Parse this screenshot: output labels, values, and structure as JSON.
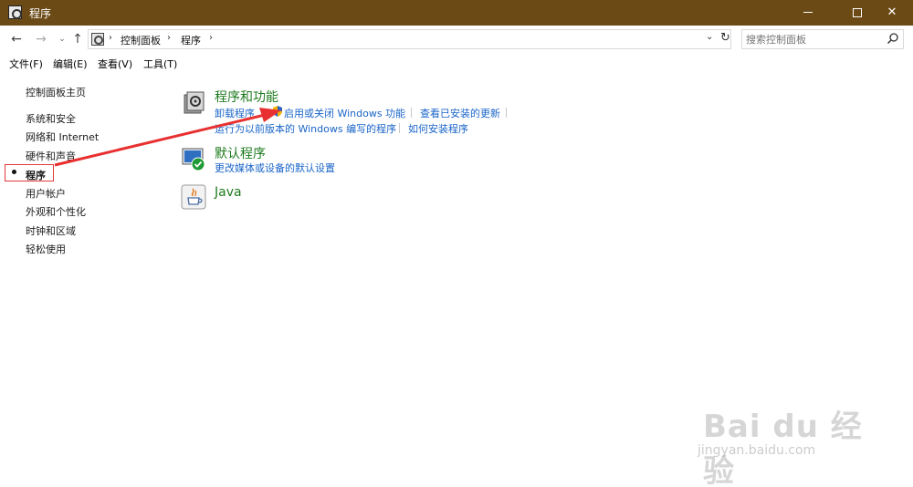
{
  "window": {
    "title": "程序",
    "min_label": "",
    "max_label": "",
    "close_label": "✕"
  },
  "nav": {
    "back": "←",
    "forward": "→",
    "recent": "⌄",
    "up": "↑"
  },
  "address": {
    "crumbs": [
      "控制面板",
      "程序"
    ],
    "separator": "›",
    "dropdown": "⌄",
    "refresh": "↻"
  },
  "search": {
    "placeholder": "搜索控制面板"
  },
  "menu": {
    "items": [
      "文件(F)",
      "编辑(E)",
      "查看(V)",
      "工具(T)"
    ]
  },
  "sidebar": {
    "items": [
      {
        "label": "控制面板主页"
      },
      {
        "label": "系统和安全"
      },
      {
        "label": "网络和 Internet"
      },
      {
        "label": "硬件和声音"
      },
      {
        "label": "程序",
        "active": true
      },
      {
        "label": "用户帐户"
      },
      {
        "label": "外观和个性化"
      },
      {
        "label": "时钟和区域"
      },
      {
        "label": "轻松使用"
      }
    ]
  },
  "categories": [
    {
      "title": "程序和功能",
      "icon": "programs-features-icon",
      "links_row1": [
        "卸载程序",
        "启用或关闭 Windows 功能",
        "查看已安装的更新"
      ],
      "links_row2": [
        "运行为以前版本的 Windows 编写的程序",
        "如何安装程序"
      ]
    },
    {
      "title": "默认程序",
      "icon": "default-programs-icon",
      "links_row1": [
        "更改媒体或设备的默认设置"
      ]
    },
    {
      "title": "Java",
      "icon": "java-icon"
    }
  ],
  "watermark": {
    "logo": "Bai du 经验",
    "url": "jingyan.baidu.com"
  },
  "colors": {
    "titlebar": "#6b4a15",
    "link": "#1a65c8",
    "category_title": "#1e7a1e",
    "highlight_box": "#e33b3b",
    "arrow": "#e83030"
  }
}
